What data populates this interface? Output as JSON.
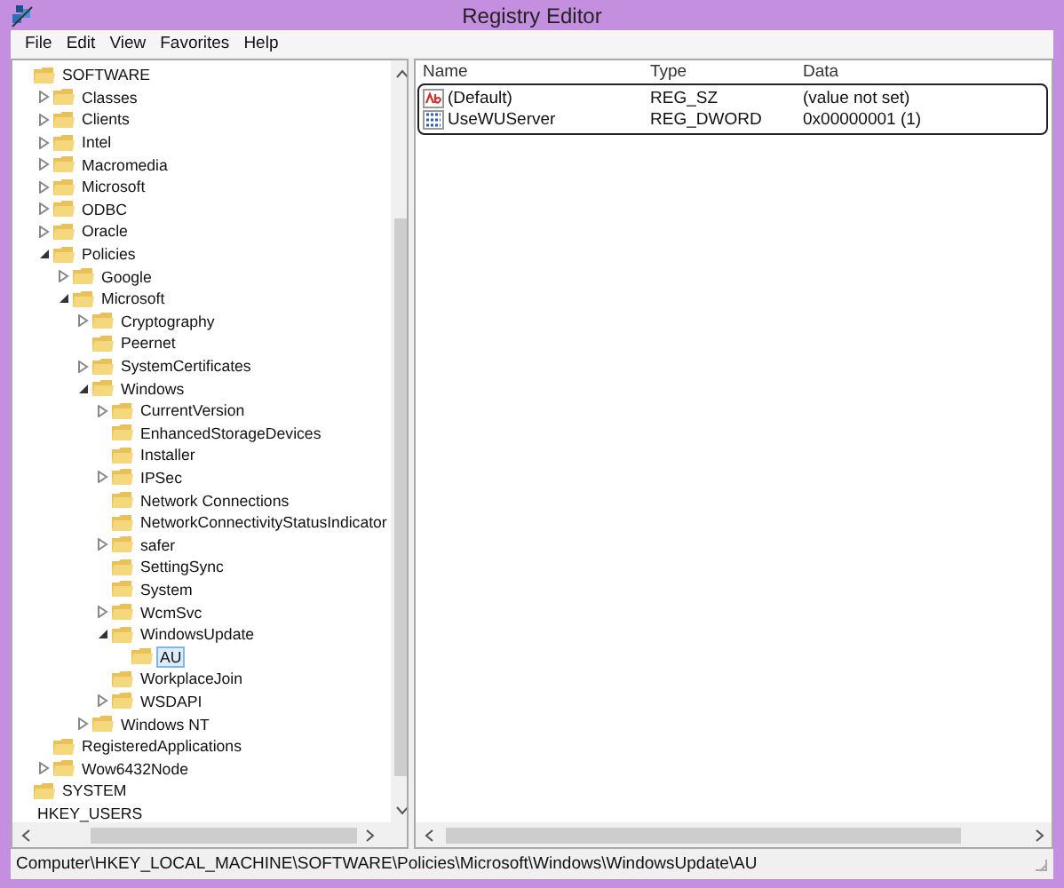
{
  "window": {
    "title": "Registry Editor"
  },
  "menu": [
    "File",
    "Edit",
    "View",
    "Favorites",
    "Help"
  ],
  "tree": [
    {
      "label": "SOFTWARE",
      "selected": false,
      "children": [
        {
          "label": "Classes",
          "expanded": false,
          "selected": false
        },
        {
          "label": "Clients",
          "expanded": false,
          "selected": false
        },
        {
          "label": "Intel",
          "expanded": false,
          "selected": false
        },
        {
          "label": "Macromedia",
          "expanded": false,
          "selected": false
        },
        {
          "label": "Microsoft",
          "expanded": false,
          "selected": false
        },
        {
          "label": "ODBC",
          "expanded": false,
          "selected": false
        },
        {
          "label": "Oracle",
          "expanded": false,
          "selected": false
        },
        {
          "label": "Policies",
          "expanded": true,
          "selected": false,
          "children": [
            {
              "label": "Google",
              "expanded": false,
              "selected": false
            },
            {
              "label": "Microsoft",
              "expanded": true,
              "selected": false,
              "children": [
                {
                  "label": "Cryptography",
                  "expanded": false,
                  "selected": false
                },
                {
                  "label": "Peernet",
                  "selected": false
                },
                {
                  "label": "SystemCertificates",
                  "expanded": false,
                  "selected": false
                },
                {
                  "label": "Windows",
                  "expanded": true,
                  "selected": false,
                  "children": [
                    {
                      "label": "CurrentVersion",
                      "expanded": false,
                      "selected": false
                    },
                    {
                      "label": "EnhancedStorageDevices",
                      "selected": false
                    },
                    {
                      "label": "Installer",
                      "selected": false
                    },
                    {
                      "label": "IPSec",
                      "expanded": false,
                      "selected": false
                    },
                    {
                      "label": "Network Connections",
                      "selected": false
                    },
                    {
                      "label": "NetworkConnectivityStatusIndicator",
                      "selected": false
                    },
                    {
                      "label": "safer",
                      "expanded": false,
                      "selected": false
                    },
                    {
                      "label": "SettingSync",
                      "selected": false
                    },
                    {
                      "label": "System",
                      "selected": false
                    },
                    {
                      "label": "WcmSvc",
                      "expanded": false,
                      "selected": false
                    },
                    {
                      "label": "WindowsUpdate",
                      "expanded": true,
                      "selected": false,
                      "children": [
                        {
                          "label": "AU",
                          "selected": true
                        }
                      ]
                    },
                    {
                      "label": "WorkplaceJoin",
                      "selected": false
                    },
                    {
                      "label": "WSDAPI",
                      "expanded": false,
                      "selected": false
                    }
                  ]
                },
                {
                  "label": "Windows NT",
                  "expanded": false,
                  "selected": false
                }
              ]
            }
          ]
        },
        {
          "label": "RegisteredApplications",
          "selected": false
        },
        {
          "label": "Wow6432Node",
          "expanded": false,
          "selected": false
        }
      ]
    },
    {
      "label": "SYSTEM",
      "selected": false
    },
    {
      "label": "HKEY_USERS",
      "kind": "hive",
      "selected": false
    }
  ],
  "columns": [
    "Name",
    "Type",
    "Data"
  ],
  "values": [
    {
      "kind": "string",
      "name": "(Default)",
      "type": "REG_SZ",
      "data": "(value not set)"
    },
    {
      "kind": "dword",
      "name": "UseWUServer",
      "type": "REG_DWORD",
      "data": "0x00000001 (1)"
    }
  ],
  "status_bar": "Computer\\HKEY_LOCAL_MACHINE\\SOFTWARE\\Policies\\Microsoft\\Windows\\WindowsUpdate\\AU"
}
